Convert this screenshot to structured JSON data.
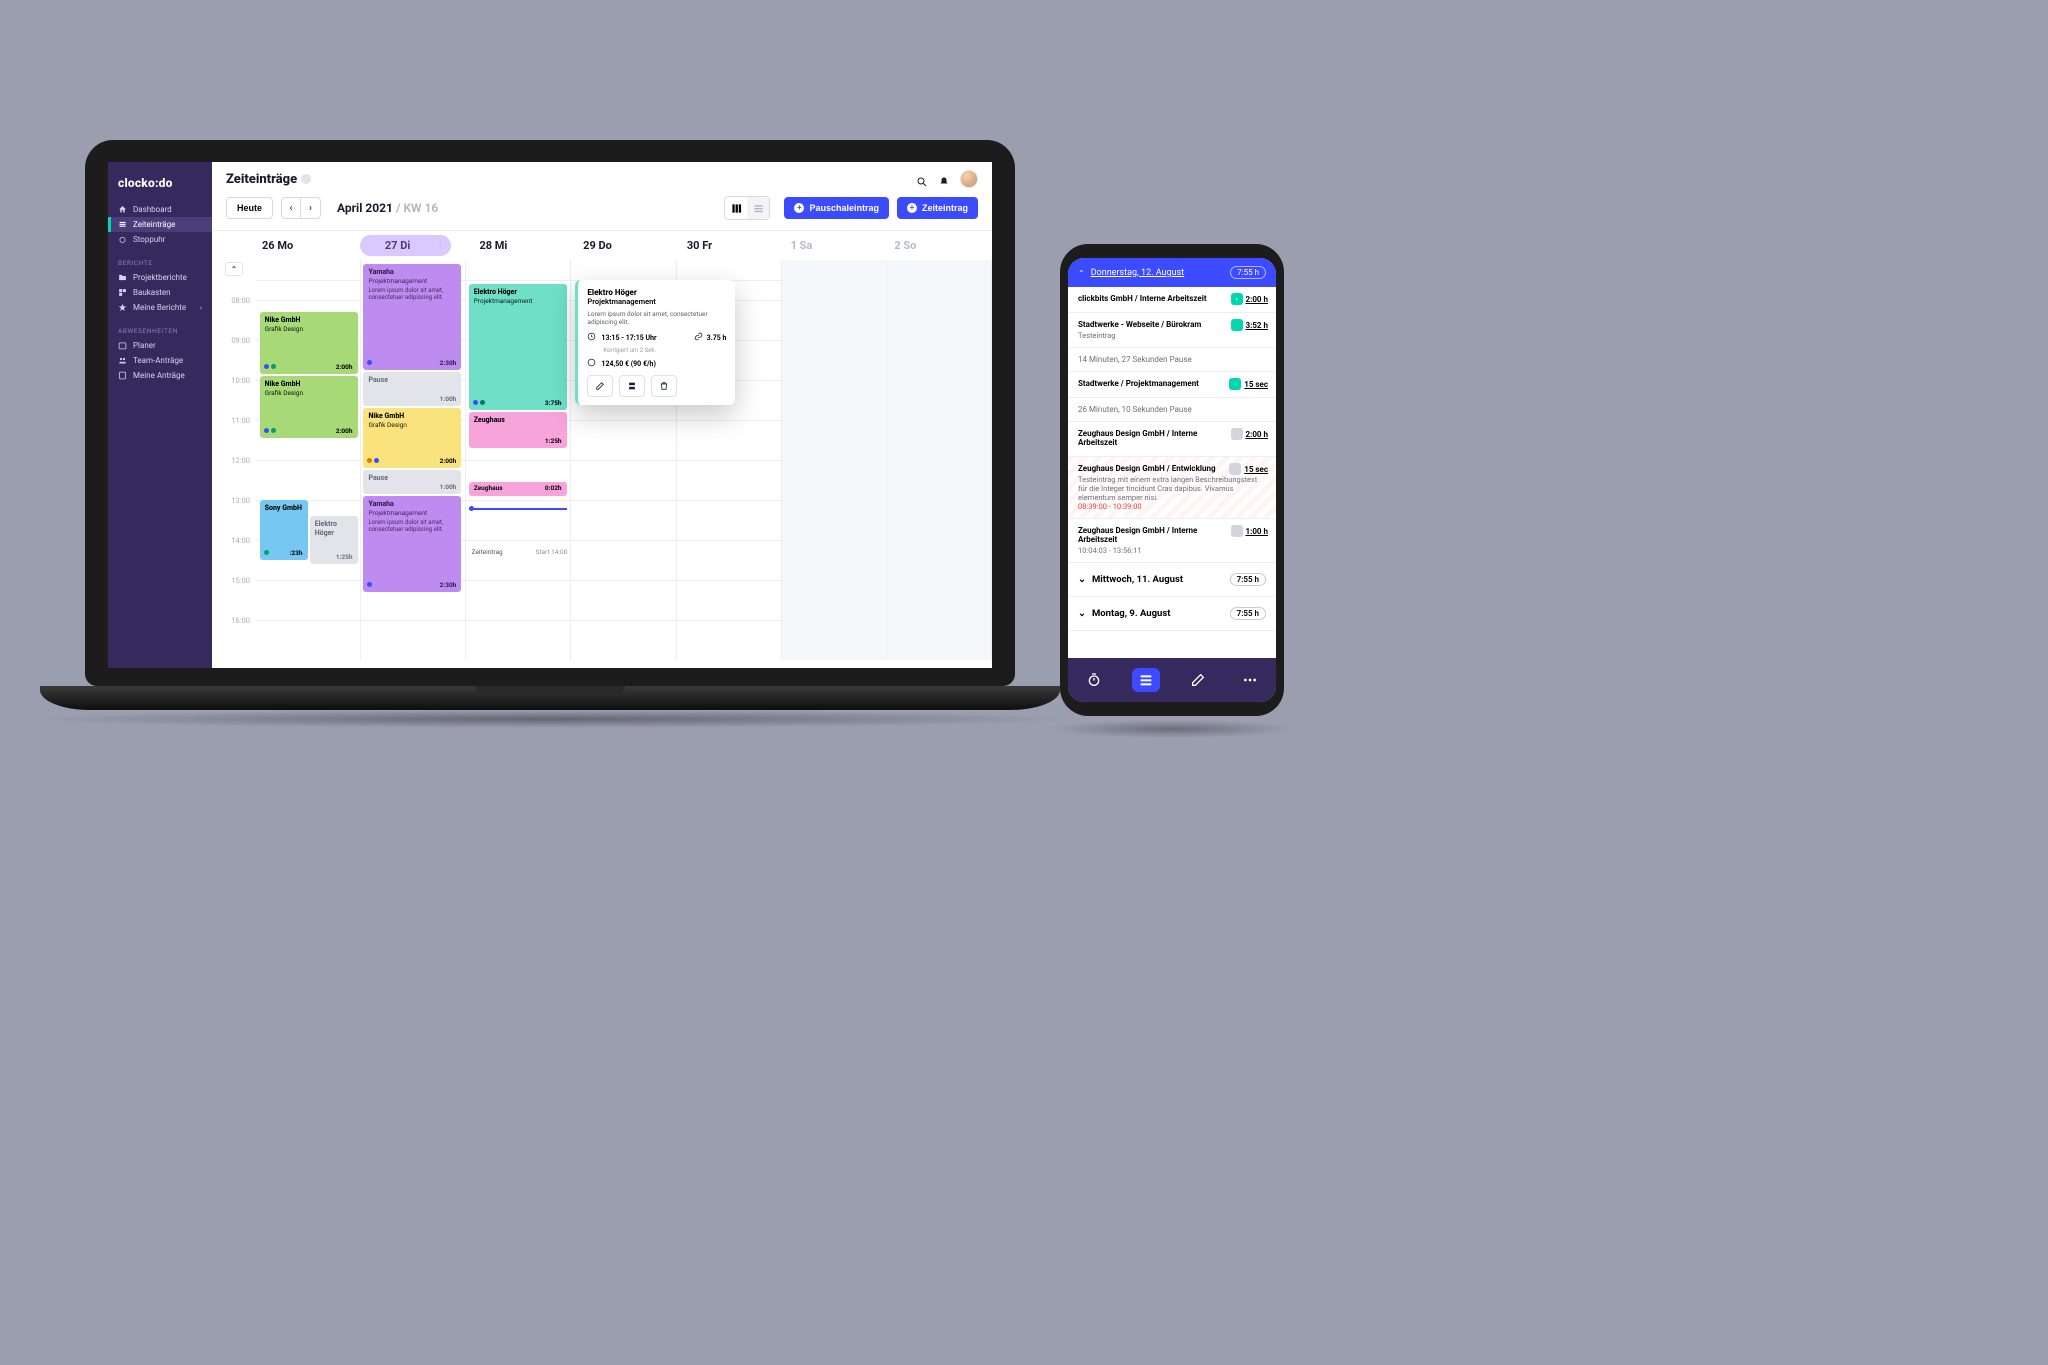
{
  "brand": "clocko:do",
  "sidebar": {
    "items": [
      {
        "label": "Dashboard"
      },
      {
        "label": "Zeiteinträge"
      },
      {
        "label": "Stoppuhr"
      }
    ],
    "section_reports": "BERICHTE",
    "reports": [
      {
        "label": "Projektberichte"
      },
      {
        "label": "Baukasten"
      },
      {
        "label": "Meine Berichte"
      }
    ],
    "section_absence": "ABWESENHEITEN",
    "absence": [
      {
        "label": "Planer"
      },
      {
        "label": "Team-Anträge"
      },
      {
        "label": "Meine Anträge"
      }
    ]
  },
  "header": {
    "title": "Zeiteinträge",
    "today": "Heute",
    "period": "April 2021",
    "week": "/ KW 16",
    "btn_pauschal": "Pauschaleintrag",
    "btn_zeit": "Zeiteintrag"
  },
  "days": [
    {
      "label": "26 Mo"
    },
    {
      "label": "27 Di"
    },
    {
      "label": "28 Mi"
    },
    {
      "label": "29 Do"
    },
    {
      "label": "30 Fr"
    },
    {
      "label": "1 Sa"
    },
    {
      "label": "2 So"
    }
  ],
  "hours": [
    "08:00",
    "09:00",
    "10:00",
    "11:00",
    "12:00",
    "13:00",
    "14:00",
    "15:00",
    "16:00"
  ],
  "entries": {
    "nike1": {
      "title": "Nike GmbH",
      "sub": "Grafik Design",
      "dur": "2:00h"
    },
    "nike2": {
      "title": "Nike GmbH",
      "sub": "Grafik Design",
      "dur": "2:00h"
    },
    "sony": {
      "title": "Sony GmbH",
      "sub": "",
      "dur": ":23h"
    },
    "hoger2": {
      "title": "Elektro Höger",
      "sub": "",
      "dur": "1:25h"
    },
    "yam1": {
      "title": "Yamaha",
      "sub": "Projektmanagement",
      "desc": "Lorem ipsum dolor sit amet, consectetuer adipiscing elit.",
      "dur": "2:30h"
    },
    "pause1": {
      "title": "Pause",
      "dur": "1:00h"
    },
    "nike3": {
      "title": "Nike GmbH",
      "sub": "Grafik Design",
      "dur": "2:00h"
    },
    "pause2": {
      "title": "Pause",
      "dur": "1:00h"
    },
    "yam2": {
      "title": "Yamaha",
      "sub": "Projektmanagement",
      "desc": "Lorem ipsum dolor sit amet, consectetuer adipiscing elit.",
      "dur": "2:30h"
    },
    "hoger1": {
      "title": "Elektro Höger",
      "sub": "Projektmanagement",
      "dur": "3:75h"
    },
    "zeug1": {
      "title": "Zeughaus",
      "dur": "1:25h"
    },
    "zeug2": {
      "title": "Zeughaus",
      "dur": "0:02h"
    },
    "startlabel": "Zeiteintrag",
    "starttime": "Start 14:00"
  },
  "popup": {
    "title": "Elektro Höger",
    "sub": "Projektmanagement",
    "desc": "Lorem ipsum dolor sit amet, consectetuer adipiscing elit.",
    "time": "13:15 - 17:15 Uhr",
    "corr": "Korrigiert um 2 Sek.",
    "dur": "3.75 h",
    "money": "124,50 € (90 €/h)"
  },
  "phone": {
    "day_active": "Donnerstag, 12. August",
    "day_active_total": "7:55 h",
    "items": [
      {
        "title": "clickbits GmbH / Interne Arbeitszeit",
        "dur": "2:00 h",
        "on": true
      },
      {
        "title": "Stadtwerke - Webseite / Bürokram",
        "sub": "Testeintrag",
        "dur": "3:52 h",
        "on": true
      },
      {
        "break": "14 Minuten, 27 Sekunden Pause"
      },
      {
        "title": "Stadtwerke / Projektmanagement",
        "dur": "15 sec",
        "on": true
      },
      {
        "break": "26 Minuten, 10 Sekunden Pause"
      },
      {
        "title": "Zeughaus Design GmbH / Interne Arbeitszeit",
        "dur": "2:00 h",
        "on": false
      },
      {
        "title": "Zeughaus Design GmbH / Entwicklung",
        "sub": "Testeintrag mit einem extra langen Beschreibungstext für die Integer tincidunt Cras dapibus. Vivamus elementum semper nisi.",
        "red": "08:39:00 - 10:39:00",
        "dur": "15 sec",
        "on": false,
        "striped": true
      },
      {
        "title": "Zeughaus Design GmbH / Interne Arbeitszeit",
        "sub": "10:04:03 - 13:56:11",
        "dur": "1:00 h",
        "on": false
      }
    ],
    "days": [
      {
        "label": "Mittwoch, 11. August",
        "total": "7:55 h"
      },
      {
        "label": "Montag, 9. August",
        "total": "7:55 h"
      }
    ]
  }
}
